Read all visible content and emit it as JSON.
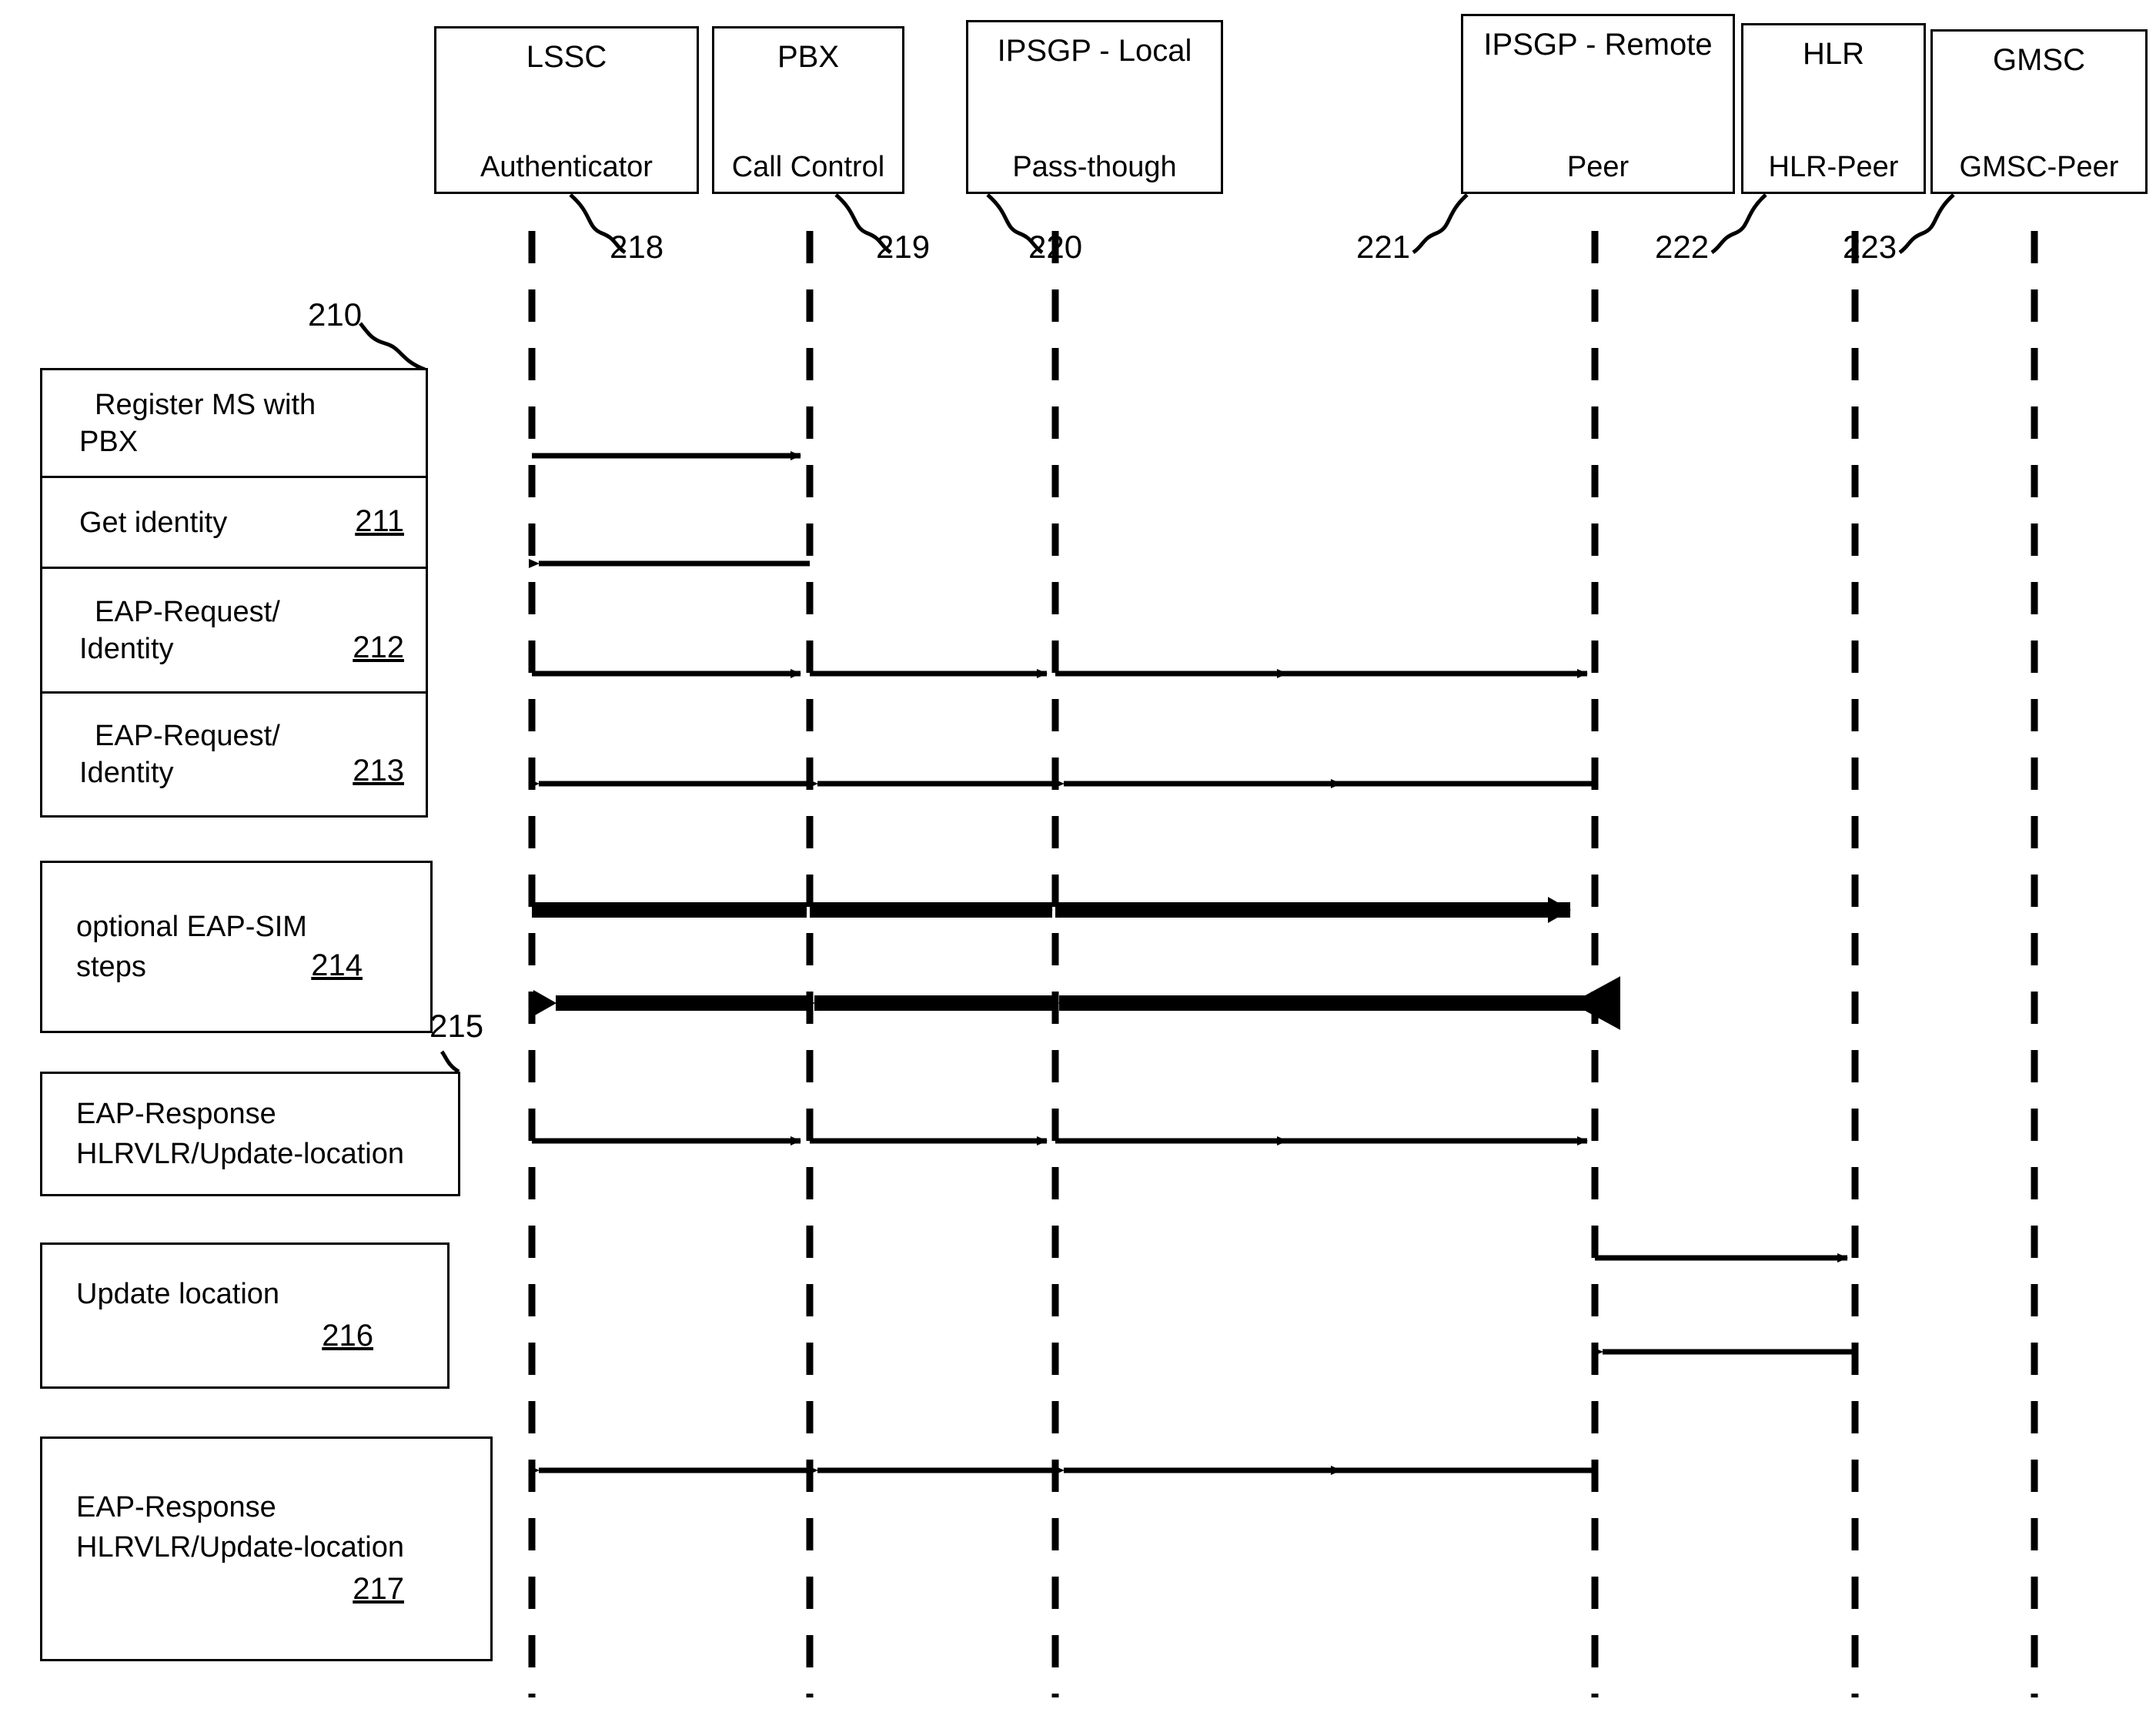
{
  "figure": {
    "type": "sequence-diagram",
    "title": "EAP-SIM registration call flow"
  },
  "actors": [
    {
      "id": "lssc",
      "title": "LSSC",
      "subtitle": "Authenticator",
      "ref": "218"
    },
    {
      "id": "pbx",
      "title": "PBX",
      "subtitle": "Call Control",
      "ref": "219"
    },
    {
      "id": "ipsgp_local",
      "title": "IPSGP - Local",
      "subtitle": "Pass-though",
      "ref": "220"
    },
    {
      "id": "ipsgp_remote",
      "title": "IPSGP - Remote",
      "subtitle": "Peer",
      "ref": "221"
    },
    {
      "id": "hlr",
      "title": "HLR",
      "subtitle": "HLR-Peer",
      "ref": "222"
    },
    {
      "id": "gmsc",
      "title": "GMSC",
      "subtitle": "GMSC-Peer",
      "ref": "223"
    }
  ],
  "step_table": {
    "ref": "210",
    "rows": [
      {
        "line1": "Register MS with",
        "line2": "PBX",
        "num": ""
      },
      {
        "line1": "Get identity",
        "line2": "",
        "num": "211"
      },
      {
        "line1": "EAP-Request/",
        "line2": "Identity",
        "num": "212"
      },
      {
        "line1": "EAP-Request/",
        "line2": "Identity",
        "num": "213"
      }
    ]
  },
  "step_boxes": [
    {
      "id": "b214",
      "line1": "optional EAP-SIM",
      "line2": "steps",
      "num": "214",
      "ref": ""
    },
    {
      "id": "b215",
      "line1": "EAP-Response",
      "line2": "HLRVLR/Update-location",
      "num": "",
      "ref": "215"
    },
    {
      "id": "b216",
      "line1": "Update location",
      "line2": "",
      "num": "216",
      "ref": ""
    },
    {
      "id": "b217",
      "line1": "EAP-Response",
      "line2": "HLRVLR/Update-location",
      "num": "217",
      "ref": ""
    }
  ],
  "messages": [
    {
      "id": "m210",
      "label": "Register MS with PBX",
      "from": "lssc",
      "to": "pbx",
      "direction": "right",
      "weight": "thin"
    },
    {
      "id": "m211",
      "label": "Get identity",
      "from": "pbx",
      "to": "lssc",
      "direction": "left",
      "weight": "thin"
    },
    {
      "id": "m212",
      "label": "EAP-Request/Identity",
      "from": "lssc",
      "to": "ipsgp_remote",
      "direction": "right",
      "weight": "thin"
    },
    {
      "id": "m213",
      "label": "EAP-Request/Identity",
      "from": "ipsgp_remote",
      "to": "lssc",
      "direction": "left",
      "weight": "thin"
    },
    {
      "id": "m214a",
      "label": "optional EAP-SIM steps",
      "from": "lssc",
      "to": "ipsgp_remote",
      "direction": "right",
      "weight": "thick"
    },
    {
      "id": "m214b",
      "label": "optional EAP-SIM steps",
      "from": "ipsgp_remote",
      "to": "lssc",
      "direction": "left",
      "weight": "thick"
    },
    {
      "id": "m215",
      "label": "EAP-Response HLRVLR/Update-location",
      "from": "lssc",
      "to": "ipsgp_remote",
      "direction": "right",
      "weight": "thin"
    },
    {
      "id": "m216a",
      "label": "Update location",
      "from": "ipsgp_remote",
      "to": "hlr",
      "direction": "right",
      "weight": "thin"
    },
    {
      "id": "m216b",
      "label": "Update location",
      "from": "hlr",
      "to": "ipsgp_remote",
      "direction": "left",
      "weight": "thin"
    },
    {
      "id": "m217",
      "label": "EAP-Response HLRVLR/Update-location",
      "from": "ipsgp_remote",
      "to": "lssc",
      "direction": "left",
      "weight": "thin"
    }
  ],
  "colors": {
    "ink": "#000000",
    "paper": "#ffffff"
  }
}
